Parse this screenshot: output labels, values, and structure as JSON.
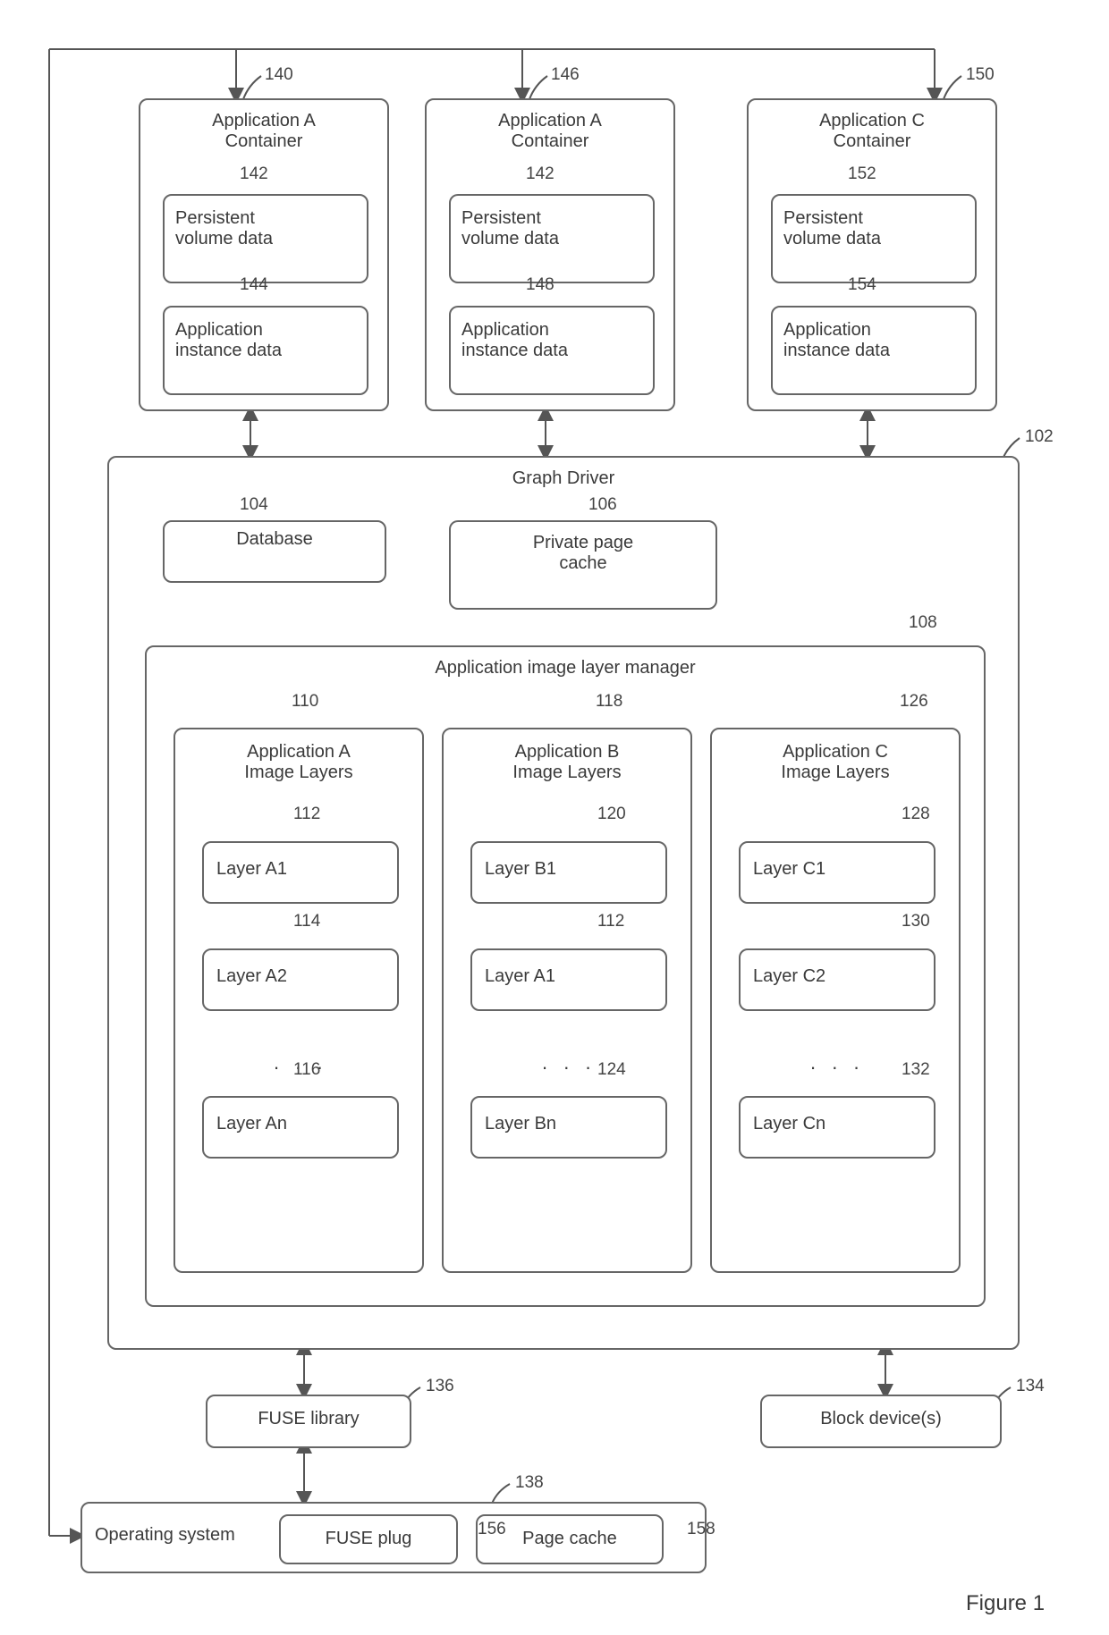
{
  "containers": [
    {
      "ref": "140",
      "title": "Application A\nContainer",
      "pv": {
        "ref": "142",
        "label": "Persistent\nvolume data"
      },
      "ai": {
        "ref": "144",
        "label": "Application\ninstance data"
      }
    },
    {
      "ref": "146",
      "title": "Application A\nContainer",
      "pv": {
        "ref": "142",
        "label": "Persistent\nvolume data"
      },
      "ai": {
        "ref": "148",
        "label": "Application\ninstance data"
      }
    },
    {
      "ref": "150",
      "title": "Application C\nContainer",
      "pv": {
        "ref": "152",
        "label": "Persistent\nvolume data"
      },
      "ai": {
        "ref": "154",
        "label": "Application\ninstance data"
      }
    }
  ],
  "graph_driver": {
    "ref": "102",
    "title": "Graph Driver",
    "database": {
      "ref": "104",
      "label": "Database"
    },
    "private_cache": {
      "ref": "106",
      "label": "Private page\ncache"
    },
    "layer_manager": {
      "ref": "108",
      "title": "Application image layer manager",
      "groups": [
        {
          "ref": "110",
          "title": "Application A\nImage Layers",
          "layers": [
            {
              "ref": "112",
              "label": "Layer A1"
            },
            {
              "ref": "114",
              "label": "Layer A2"
            },
            {
              "ref": "116",
              "label": "Layer An"
            }
          ]
        },
        {
          "ref": "118",
          "title": "Application B\nImage Layers",
          "layers": [
            {
              "ref": "120",
              "label": "Layer B1"
            },
            {
              "ref": "112",
              "label": "Layer A1"
            },
            {
              "ref": "124",
              "label": "Layer Bn"
            }
          ]
        },
        {
          "ref": "126",
          "title": "Application C\nImage Layers",
          "layers": [
            {
              "ref": "128",
              "label": "Layer C1"
            },
            {
              "ref": "130",
              "label": "Layer C2"
            },
            {
              "ref": "132",
              "label": "Layer Cn"
            }
          ]
        }
      ]
    }
  },
  "fuse_library": {
    "ref": "136",
    "label": "FUSE library"
  },
  "block_devices": {
    "ref": "134",
    "label": "Block device(s)"
  },
  "os": {
    "ref": "138",
    "label": "Operating system",
    "fuse_plug": {
      "ref": "156",
      "label": "FUSE plug"
    },
    "page_cache": {
      "ref": "158",
      "label": "Page cache"
    }
  },
  "figure_caption": "Figure 1"
}
